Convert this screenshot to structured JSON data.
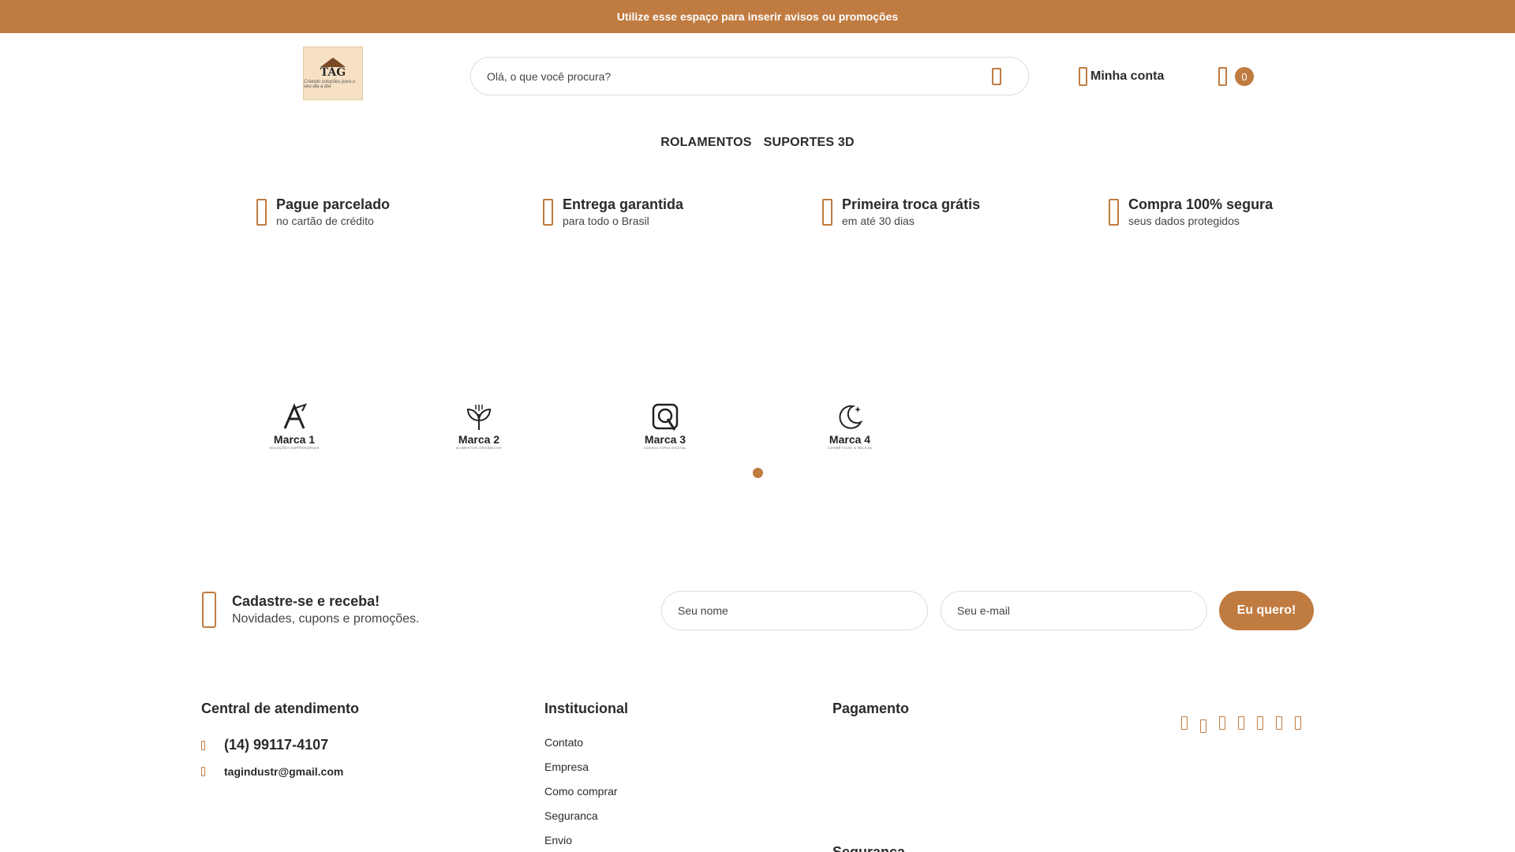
{
  "announcement": "Utilize esse espaço para inserir avisos ou promoções",
  "logo": {
    "text": "TAG",
    "tagline": "Criando soluções para o seu dia a dia"
  },
  "search": {
    "placeholder": "Olá, o que você procura?"
  },
  "account": {
    "label": "Minha conta"
  },
  "cart": {
    "count": "0"
  },
  "nav": {
    "items": [
      "ROLAMENTOS",
      "SUPORTES 3D"
    ]
  },
  "benefits": [
    {
      "title": "Pague parcelado",
      "subtitle": "no cartão de crédito",
      "icon": "card-icon"
    },
    {
      "title": "Entrega garantida",
      "subtitle": "para todo o Brasil",
      "icon": "truck-icon"
    },
    {
      "title": "Primeira troca grátis",
      "subtitle": "em até 30 dias",
      "icon": "exchange-icon"
    },
    {
      "title": "Compra 100% segura",
      "subtitle": "seus dados protegidos",
      "icon": "shield-icon"
    }
  ],
  "brands": [
    {
      "name": "Marca 1",
      "tagline": "SOLUÇÕES EMPRESARIAIS"
    },
    {
      "name": "Marca 2",
      "tagline": "ALIMENTOS ORGÂNICOS"
    },
    {
      "name": "Marca 3",
      "tagline": "CONSULTORIA DIGITAL"
    },
    {
      "name": "Marca 4",
      "tagline": "COSMÉTICOS & BELEZA"
    }
  ],
  "newsletter": {
    "title": "Cadastre-se e receba!",
    "subtitle": "Novidades, cupons e promoções.",
    "name_placeholder": "Seu nome",
    "email_placeholder": "Seu e-mail",
    "button": "Eu quero!"
  },
  "footer": {
    "service": {
      "title": "Central de atendimento",
      "phone": "(14) 99117-4107",
      "email": "tagindustr@gmail.com"
    },
    "institutional": {
      "title": "Institucional",
      "links": [
        "Contato",
        "Empresa",
        "Como comprar",
        "Seguranca",
        "Envio"
      ]
    },
    "payment": {
      "title": "Pagamento"
    },
    "security": {
      "title": "Segurança"
    }
  },
  "colors": {
    "accent": "#c07b40",
    "text": "#2b2b2b"
  },
  "social_icons": [
    "facebook-icon",
    "instagram-icon",
    "youtube-icon",
    "twitter-icon",
    "pinterest-icon",
    "tiktok-icon",
    "whatsapp-icon"
  ]
}
